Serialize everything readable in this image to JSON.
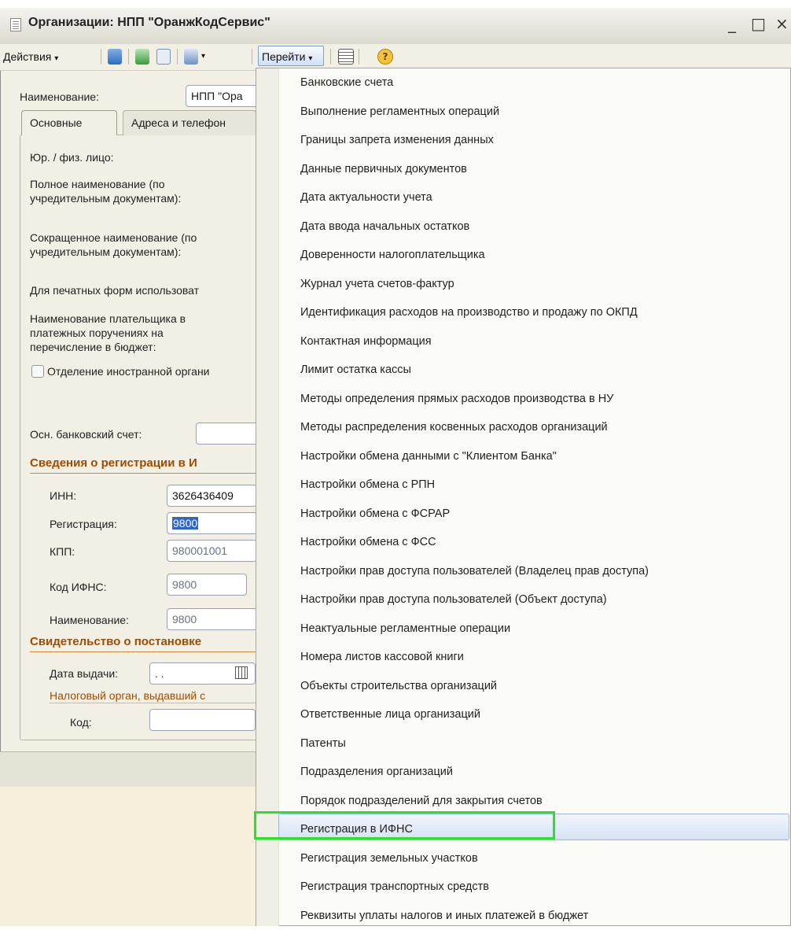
{
  "window": {
    "title": "Организации: НПП \"ОранжКодСервис\"",
    "controls": {
      "minimize": "_",
      "maximize": "□",
      "close": "×"
    }
  },
  "toolbar": {
    "actions_label": "Действия",
    "goto_label": "Перейти",
    "dropdown_glyph": "▾",
    "help_glyph": "?"
  },
  "form": {
    "name_label": "Наименование:",
    "name_value": "НПП \"Ора",
    "tabs": [
      "Основные",
      "Адреса и телефон"
    ],
    "legal_type_label": "Юр. / физ. лицо:",
    "full_name_label_1": "Полное наименование (по",
    "full_name_label_2": "учредительным документам):",
    "short_name_label_1": "Сокращенное наименование (по",
    "short_name_label_2": "учредительным документам):",
    "print_forms_label": "Для печатных форм использоват",
    "payer_name_label_1": "Наименование плательщика в",
    "payer_name_label_2": "платежных поручениях на",
    "payer_name_label_3": "перечисление в бюджет:",
    "foreign_checkbox_label": "Отделение иностранной органи",
    "bank_account_label": "Осн. банковский счет:",
    "registration_section": "Сведения о регистрации в И",
    "inn_label": "ИНН:",
    "inn_value": "3626436409",
    "registration_label": "Регистрация:",
    "registration_value": "9800",
    "kpp_label": "КПП:",
    "kpp_value": "980001001",
    "ifns_code_label": "Код ИФНС:",
    "ifns_code_value": "9800",
    "ifns_name_label": "Наименование:",
    "ifns_name_value": "9800",
    "certificate_section": "Свидетельство о постановке",
    "issue_date_label": "Дата выдачи:",
    "issue_date_value": ". .",
    "tax_authority_link": "Налоговый орган, выдавший с",
    "code_label": "Код:"
  },
  "menu": {
    "items": [
      "Банковские счета",
      "Выполнение регламентных операций",
      "Границы запрета изменения данных",
      "Данные первичных документов",
      "Дата актуальности учета",
      "Дата ввода начальных остатков",
      "Доверенности налогоплательщика",
      "Журнал учета счетов-фактур",
      "Идентификация расходов на производство и продажу по ОКПД",
      "Контактная информация",
      "Лимит остатка кассы",
      "Методы определения прямых расходов производства в НУ",
      "Методы распределения косвенных расходов организаций",
      "Настройки обмена данными с \"Клиентом Банка\"",
      "Настройки обмена с РПН",
      "Настройки обмена с ФСРАР",
      "Настройки обмена с ФСС",
      "Настройки прав доступа пользователей (Владелец прав доступа)",
      "Настройки прав доступа пользователей (Объект доступа)",
      "Неактуальные регламентные операции",
      "Номера листов кассовой книги",
      "Объекты строительства организаций",
      "Ответственные лица организаций",
      "Патенты",
      "Подразделения организаций",
      "Порядок подразделений для закрытия счетов",
      "Регистрация в ИФНС",
      "Регистрация земельных участков",
      "Регистрация транспортных средств",
      "Реквизиты уплаты налогов и иных платежей в бюджет"
    ],
    "selected_index": 26
  },
  "colors": {
    "highlight_box": "#28e428",
    "section_header": "#a04c00",
    "selection_fill": "#d6e2f5"
  }
}
